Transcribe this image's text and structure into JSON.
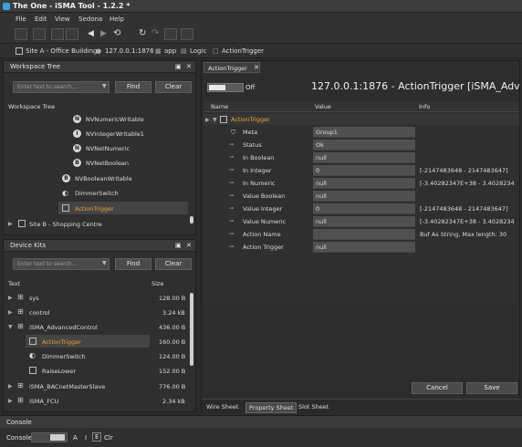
{
  "app": {
    "title": "The One - iSMA Tool - 1.2.2 *"
  },
  "menu": [
    "File",
    "Edit",
    "View",
    "Sedona",
    "Help"
  ],
  "breadcrumb": [
    "Site A - Office Building",
    "127.0.0.1:1876",
    "app",
    "Logic",
    "ActionTrigger"
  ],
  "workspace": {
    "panel_title": "Workspace Tree",
    "search_placeholder": "Enter text to search...",
    "find": "Find",
    "clear": "Clear",
    "tree_label": "Workspace Tree",
    "items": [
      {
        "label": "NVNumericWritable",
        "icon": "N"
      },
      {
        "label": "NVIntegerWritable1",
        "icon": "I"
      },
      {
        "label": "NVNetNumeric",
        "icon": "N"
      },
      {
        "label": "NVNetBoolean",
        "icon": "B"
      },
      {
        "label": "NVBooleanWritable",
        "icon": "B"
      },
      {
        "label": "DimmerSwitch",
        "icon": "dimmer"
      },
      {
        "label": "ActionTrigger",
        "icon": "action"
      }
    ],
    "site_b": "Site B - Shopping Centre"
  },
  "devicekits": {
    "panel_title": "Device Kits",
    "search_placeholder": "Enter text to search...",
    "find": "Find",
    "clear": "Clear",
    "col_text": "Text",
    "col_size": "Size",
    "rows": [
      {
        "label": "sys",
        "size": "128.00 B",
        "level": 0
      },
      {
        "label": "control",
        "size": "3.24 kB",
        "level": 0
      },
      {
        "label": "iSMA_AdvancedControl",
        "size": "436.00 B",
        "level": 0
      },
      {
        "label": "ActionTrigger",
        "size": "160.00 B",
        "level": 1
      },
      {
        "label": "DimmerSwitch",
        "size": "124.00 B",
        "level": 1
      },
      {
        "label": "RaiseLower",
        "size": "152.00 B",
        "level": 1
      },
      {
        "label": "iSMA_BACnetMasterSlave",
        "size": "776.00 B",
        "level": 0
      },
      {
        "label": "iSMA_FCU",
        "size": "2.34 kB",
        "level": 0
      }
    ]
  },
  "editor": {
    "tab": "ActionTrigger",
    "toggle_label": "Off",
    "heading": "127.0.0.1:1876 - ActionTrigger [iSMA_Advanc",
    "columns": [
      "Name",
      "Value",
      "Info"
    ],
    "root": "ActionTrigger",
    "properties": [
      {
        "name": "Meta",
        "value": "Group1",
        "info": ""
      },
      {
        "name": "Status",
        "value": "Ok",
        "info": ""
      },
      {
        "name": "In Boolean",
        "value": "null",
        "info": ""
      },
      {
        "name": "In Integer",
        "value": "0",
        "info": "[-2147483648 - 2147483647]"
      },
      {
        "name": "In Numeric",
        "value": "null",
        "info": "[-3.40282347E+38 - 3.4028234"
      },
      {
        "name": "Value Boolean",
        "value": "null",
        "info": ""
      },
      {
        "name": "Value Integer",
        "value": "0",
        "info": "[-2147483648 - 2147483647]"
      },
      {
        "name": "Value Numeric",
        "value": "null",
        "info": "[-3.40282347E+38 - 3.4028234"
      },
      {
        "name": "Action Name",
        "value": "",
        "info": "Buf As String, Max length: 30"
      },
      {
        "name": "Action Trigger",
        "value": "null",
        "info": ""
      }
    ],
    "cancel": "Cancel",
    "save": "Save",
    "bottom_tabs": [
      "Wire Sheet",
      "Property Sheet",
      "Slot Sheet"
    ]
  },
  "console": {
    "title": "Console",
    "label": "Console",
    "buttons": [
      "A",
      "I",
      "E",
      "Clr"
    ]
  }
}
